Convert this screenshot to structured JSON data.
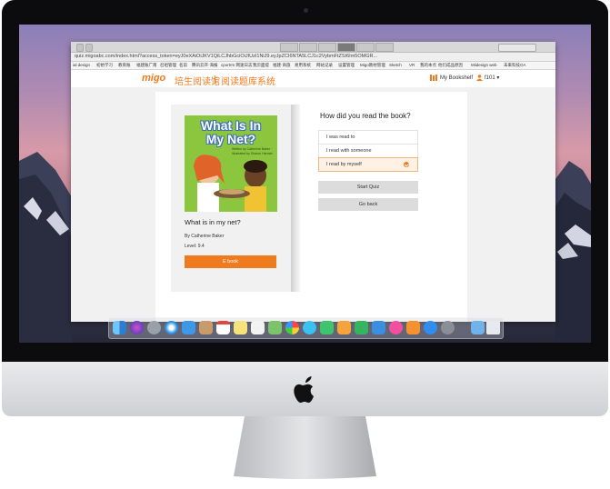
{
  "browser": {
    "url": "quiz.migoabc.com/index.html?access_token=eyJ0eXAiOiJKV1QiLCJhbGciOiJIUzI1NiJ9.eyJpZCI6NTA5LCJ1c2VybmFtZSI6Im5OMGR..."
  },
  "bookmarks": [
    "ial design",
    "初始学习",
    "教育账",
    "福建账广南",
    "召祖管理",
    "名前",
    "腾讯云开·海报",
    "cportrm 网速日志",
    "我页面提",
    "福建·商旅",
    "易用系统",
    "网站记录",
    "设置管理",
    "Migo教材管理",
    "Sketch",
    "VR",
    "我的本点",
    "他们成品原因",
    "Miidesign web",
    "未来科技OA"
  ],
  "header": {
    "logo_text": "migo",
    "brand_cn": "培生阅读馆",
    "brand_sub": "阅读题库系统",
    "bookshelf_label": "My Bookshelf",
    "user_label": "f101 ▾"
  },
  "book": {
    "cover_title_line1": "What Is In",
    "cover_title_line2": "My Net?",
    "cover_credit": "Written by Catherine Baker · Illustrated by Sharon Harmer",
    "title": "What is in my net?",
    "author": "By Catherine Baker",
    "level": "Level: 9.4",
    "ebook_button": "E book"
  },
  "quiz": {
    "question": "How did you read the book?",
    "options": [
      {
        "label": "I was read to",
        "selected": false
      },
      {
        "label": "I read with someone",
        "selected": false
      },
      {
        "label": "I read by myself",
        "selected": true
      }
    ],
    "start_button": "Start Quiz",
    "back_button": "Go back"
  },
  "colors": {
    "accent": "#f07a1e",
    "selected_bg": "#fff1e3",
    "button_gray": "#dcdcdc",
    "page_bg": "#f1f1f1"
  },
  "dock": {
    "icons": [
      "finder-icon",
      "siri-icon",
      "launchpad-icon",
      "safari-icon",
      "mail-icon",
      "contacts-icon",
      "calendar-icon",
      "notes-icon",
      "reminders-icon",
      "maps-icon",
      "photos-icon",
      "messages-icon",
      "facetime-icon",
      "pages-icon",
      "numbers-icon",
      "keynote-icon",
      "itunes-icon",
      "ibooks-icon",
      "app-store-icon",
      "preferences-icon",
      "folder-icon",
      "trash-icon"
    ]
  }
}
